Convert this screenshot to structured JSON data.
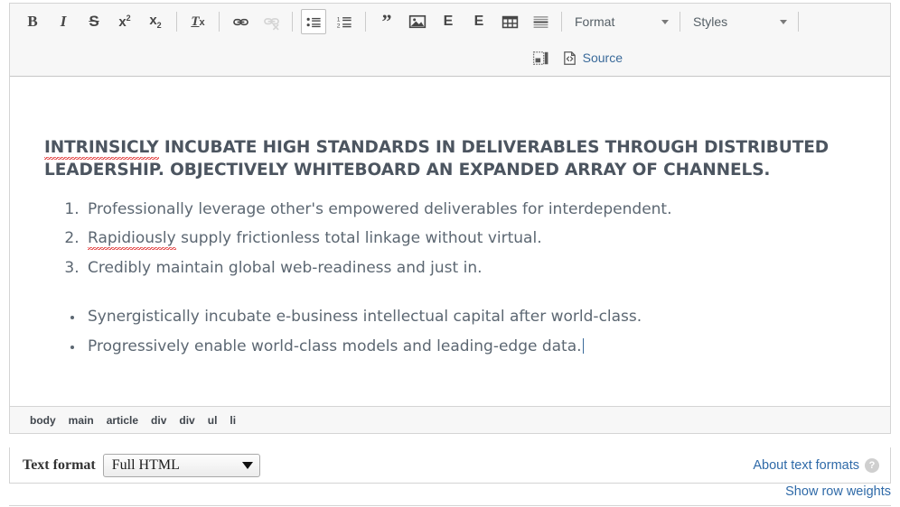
{
  "editor": {
    "toolbar": {
      "row1": [
        {
          "name": "bold-button",
          "icon": "bold-icon",
          "label": "B",
          "active": false,
          "disabled": false
        },
        {
          "name": "italic-button",
          "icon": "italic-icon",
          "label": "I",
          "active": false,
          "disabled": false
        },
        {
          "name": "strikethrough-button",
          "icon": "strikethrough-icon",
          "label": "S",
          "active": false,
          "disabled": false
        },
        {
          "name": "superscript-button",
          "icon": "superscript-icon",
          "label": "x2",
          "active": false,
          "disabled": false
        },
        {
          "name": "subscript-button",
          "icon": "subscript-icon",
          "label": "x2",
          "active": false,
          "disabled": false
        },
        {
          "name": "separator",
          "icon": "separator",
          "label": "",
          "active": false,
          "disabled": false
        },
        {
          "name": "remove-format-button",
          "icon": "remove-format-icon",
          "label": "Tx",
          "active": false,
          "disabled": false
        },
        {
          "name": "separator",
          "icon": "separator",
          "label": "",
          "active": false,
          "disabled": false
        },
        {
          "name": "link-button",
          "icon": "link-icon",
          "label": "",
          "active": false,
          "disabled": false
        },
        {
          "name": "unlink-button",
          "icon": "unlink-icon",
          "label": "",
          "active": false,
          "disabled": true
        },
        {
          "name": "separator",
          "icon": "separator",
          "label": "",
          "active": false,
          "disabled": false
        },
        {
          "name": "bulleted-list-button",
          "icon": "bulleted-list-icon",
          "label": "",
          "active": true,
          "disabled": false
        },
        {
          "name": "numbered-list-button",
          "icon": "numbered-list-icon",
          "label": "",
          "active": false,
          "disabled": false
        },
        {
          "name": "separator",
          "icon": "separator",
          "label": "",
          "active": false,
          "disabled": false
        },
        {
          "name": "blockquote-button",
          "icon": "blockquote-icon",
          "label": "",
          "active": false,
          "disabled": false
        },
        {
          "name": "image-button",
          "icon": "image-icon",
          "label": "",
          "active": false,
          "disabled": false
        },
        {
          "name": "entity-embed-button",
          "icon": "embed-e-icon",
          "label": "E",
          "active": false,
          "disabled": false
        },
        {
          "name": "entity-embed-2-button",
          "icon": "embed-e-icon",
          "label": "E",
          "active": false,
          "disabled": false
        },
        {
          "name": "table-button",
          "icon": "table-icon",
          "label": "",
          "active": false,
          "disabled": false
        },
        {
          "name": "horizontal-rule-button",
          "icon": "horizontal-rule-icon",
          "label": "",
          "active": false,
          "disabled": false
        },
        {
          "name": "separator",
          "icon": "separator",
          "label": "",
          "active": false,
          "disabled": false
        }
      ],
      "format_dropdown": {
        "label": "Format"
      },
      "styles_dropdown": {
        "label": "Styles"
      },
      "templates_button": {
        "label": ""
      },
      "source_button": {
        "label": "Source"
      }
    },
    "content": {
      "heading": {
        "misspelled": "INTRINSICLY",
        "rest": " INCUBATE HIGH STANDARDS IN DELIVERABLES THROUGH DISTRIBUTED LEADERSHIP. OBJECTIVELY WHITEBOARD AN EXPANDED ARRAY OF CHANNELS."
      },
      "ordered_list": [
        {
          "pre": "",
          "misspelled": "",
          "text": "Professionally leverage other's empowered deliverables for interdependent."
        },
        {
          "pre": "",
          "misspelled": "Rapidiously",
          "text": " supply frictionless total linkage without virtual."
        },
        {
          "pre": "",
          "misspelled": "",
          "text": "Credibly maintain global web-readiness and just in."
        }
      ],
      "bulleted_list": [
        {
          "text": "Synergistically incubate e-business intellectual capital after world-class.",
          "caret": false
        },
        {
          "text": "Progressively enable world-class models and leading-edge data.",
          "caret": true
        }
      ]
    },
    "elements_path": [
      "body",
      "main",
      "article",
      "div",
      "div",
      "ul",
      "li"
    ]
  },
  "footer": {
    "text_format_label": "Text format",
    "text_format_value": "Full HTML",
    "about_text_formats": "About text formats",
    "help_icon_label": "?",
    "show_row_weights": "Show row weights"
  },
  "colors": {
    "link": "#2f6aa8",
    "heading_text": "#4c5560",
    "body_text": "#5c6772",
    "spellcheck": "#e03030",
    "toolbar_bg": "#f7f7f7",
    "border": "#d4d4d4"
  }
}
